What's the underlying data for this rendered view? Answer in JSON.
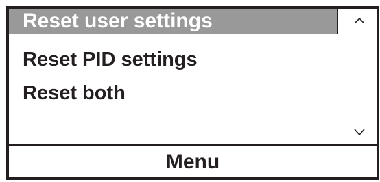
{
  "menu": {
    "items": [
      {
        "label": "Reset user settings",
        "selected": true
      },
      {
        "label": "Reset PID settings",
        "selected": false
      },
      {
        "label": "Reset both",
        "selected": false
      }
    ]
  },
  "scroll": {
    "up_icon": "chevron-up-icon",
    "down_icon": "chevron-down-icon"
  },
  "footer": {
    "label": "Menu"
  },
  "colors": {
    "border": "#231f20",
    "selection": "#999999",
    "background": "#ffffff"
  }
}
